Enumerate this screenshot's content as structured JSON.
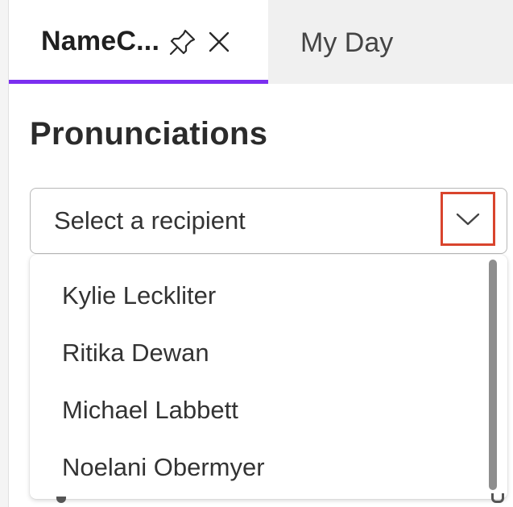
{
  "tabs": [
    {
      "label": "NameC...",
      "active": true
    },
    {
      "label": "My Day",
      "active": false
    }
  ],
  "icons": {
    "pin": "pin-icon",
    "close": "close-icon",
    "dropdown": "chevron-down-icon"
  },
  "page_title": "Pronunciations",
  "recipient_select": {
    "placeholder": "Select a recipient",
    "options": [
      "Kylie Leckliter",
      "Ritika Dewan",
      "Michael Labbett",
      "Noelani Obermyer"
    ]
  },
  "colors": {
    "accent": "#7b2ff0",
    "highlight": "#d9442d",
    "tab_bar_background": "#f0f0f0",
    "text": "#333333"
  }
}
